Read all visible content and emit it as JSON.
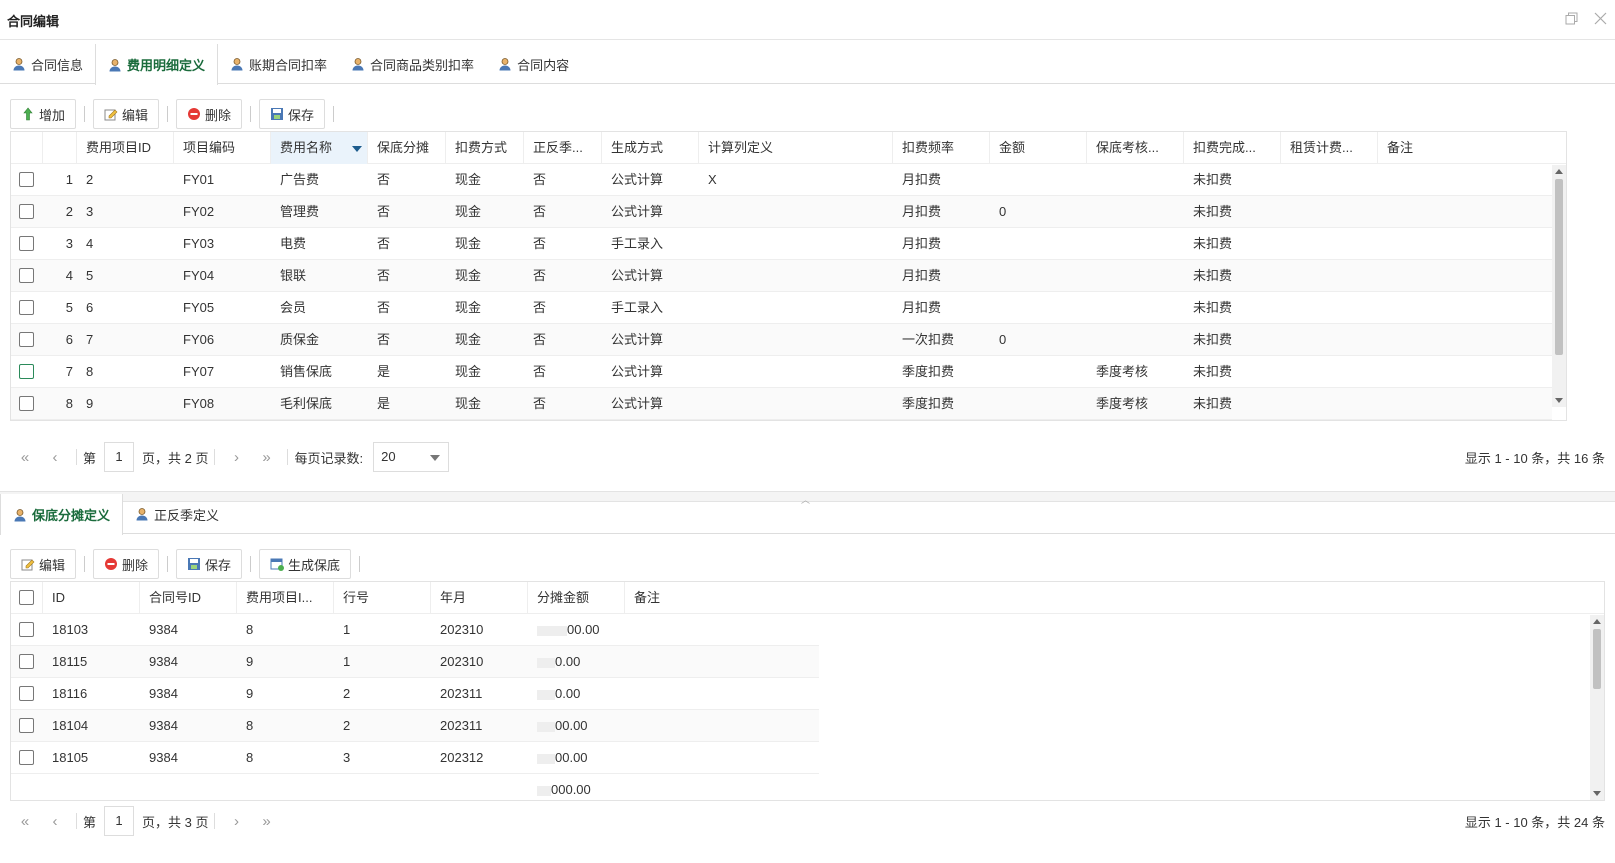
{
  "window": {
    "title": "合同编辑"
  },
  "top_tabs": [
    {
      "label": "合同信息",
      "active": false
    },
    {
      "label": "费用明细定义",
      "active": true
    },
    {
      "label": "账期合同扣率",
      "active": false
    },
    {
      "label": "合同商品类别扣率",
      "active": false
    },
    {
      "label": "合同内容",
      "active": false
    }
  ],
  "top_toolbar": {
    "add": "增加",
    "edit": "编辑",
    "delete": "删除",
    "save": "保存"
  },
  "top_grid": {
    "columns": [
      "费用项目ID",
      "项目编码",
      "费用名称",
      "保底分摊",
      "扣费方式",
      "正反季...",
      "生成方式",
      "计算列定义",
      "扣费频率",
      "金额",
      "保底考核...",
      "扣费完成...",
      "租赁计费...",
      "备注"
    ],
    "rows": [
      {
        "num": "1",
        "id": "2",
        "code": "FY01",
        "name": "广告费",
        "share": "否",
        "method": "现金",
        "season": "否",
        "gen": "公式计算",
        "calc": "X",
        "freq": "月扣费",
        "amount": "",
        "assess": "",
        "done": "未扣费",
        "note": ""
      },
      {
        "num": "2",
        "id": "3",
        "code": "FY02",
        "name": "管理费",
        "share": "否",
        "method": "现金",
        "season": "否",
        "gen": "公式计算",
        "calc": "",
        "freq": "月扣费",
        "amount": "0",
        "assess": "",
        "done": "未扣费",
        "note": ""
      },
      {
        "num": "3",
        "id": "4",
        "code": "FY03",
        "name": "电费",
        "share": "否",
        "method": "现金",
        "season": "否",
        "gen": "手工录入",
        "calc": "",
        "freq": "月扣费",
        "amount": "",
        "assess": "",
        "done": "未扣费",
        "note": ""
      },
      {
        "num": "4",
        "id": "5",
        "code": "FY04",
        "name": "银联",
        "share": "否",
        "method": "现金",
        "season": "否",
        "gen": "公式计算",
        "calc": "",
        "freq": "月扣费",
        "amount": "",
        "assess": "",
        "done": "未扣费",
        "note": ""
      },
      {
        "num": "5",
        "id": "6",
        "code": "FY05",
        "name": "会员",
        "share": "否",
        "method": "现金",
        "season": "否",
        "gen": "手工录入",
        "calc": "",
        "freq": "月扣费",
        "amount": "",
        "assess": "",
        "done": "未扣费",
        "note": ""
      },
      {
        "num": "6",
        "id": "7",
        "code": "FY06",
        "name": "质保金",
        "share": "否",
        "method": "现金",
        "season": "否",
        "gen": "公式计算",
        "calc": "",
        "freq": "一次扣费",
        "amount": "0",
        "assess": "",
        "done": "未扣费",
        "note": ""
      },
      {
        "num": "7",
        "id": "8",
        "code": "FY07",
        "name": "销售保底",
        "share": "是",
        "method": "现金",
        "season": "否",
        "gen": "公式计算",
        "calc": "",
        "freq": "季度扣费",
        "amount": "",
        "assess": "季度考核",
        "done": "未扣费",
        "note": ""
      },
      {
        "num": "8",
        "id": "9",
        "code": "FY08",
        "name": "毛利保底",
        "share": "是",
        "method": "现金",
        "season": "否",
        "gen": "公式计算",
        "calc": "",
        "freq": "季度扣费",
        "amount": "",
        "assess": "季度考核",
        "done": "未扣费",
        "note": ""
      }
    ]
  },
  "top_pager": {
    "page_prefix": "第",
    "page": "1",
    "page_suffix": "页，共 2 页",
    "size_label": "每页记录数:",
    "size": "20",
    "info": "显示 1 - 10 条，共 16 条"
  },
  "bottom_tabs": [
    {
      "label": "保底分摊定义",
      "active": true
    },
    {
      "label": "正反季定义",
      "active": false
    }
  ],
  "bottom_toolbar": {
    "edit": "编辑",
    "delete": "删除",
    "save": "保存",
    "generate": "生成保底"
  },
  "bottom_grid": {
    "columns": [
      "ID",
      "合同号ID",
      "费用项目I...",
      "行号",
      "年月",
      "分摊金额",
      "备注"
    ],
    "rows": [
      {
        "id": "18103",
        "contract": "9384",
        "item": "8",
        "line": "1",
        "ym": "202310",
        "amount": "00.00"
      },
      {
        "id": "18115",
        "contract": "9384",
        "item": "9",
        "line": "1",
        "ym": "202310",
        "amount": "0.00"
      },
      {
        "id": "18116",
        "contract": "9384",
        "item": "9",
        "line": "2",
        "ym": "202311",
        "amount": "0.00"
      },
      {
        "id": "18104",
        "contract": "9384",
        "item": "8",
        "line": "2",
        "ym": "202311",
        "amount": "00.00"
      },
      {
        "id": "18105",
        "contract": "9384",
        "item": "8",
        "line": "3",
        "ym": "202312",
        "amount": "00.00"
      }
    ],
    "footer_total": "000.00"
  },
  "bottom_pager": {
    "page_prefix": "第",
    "page": "1",
    "page_suffix": "页，共 3 页",
    "info": "显示 1 - 10 条，共 24 条"
  }
}
